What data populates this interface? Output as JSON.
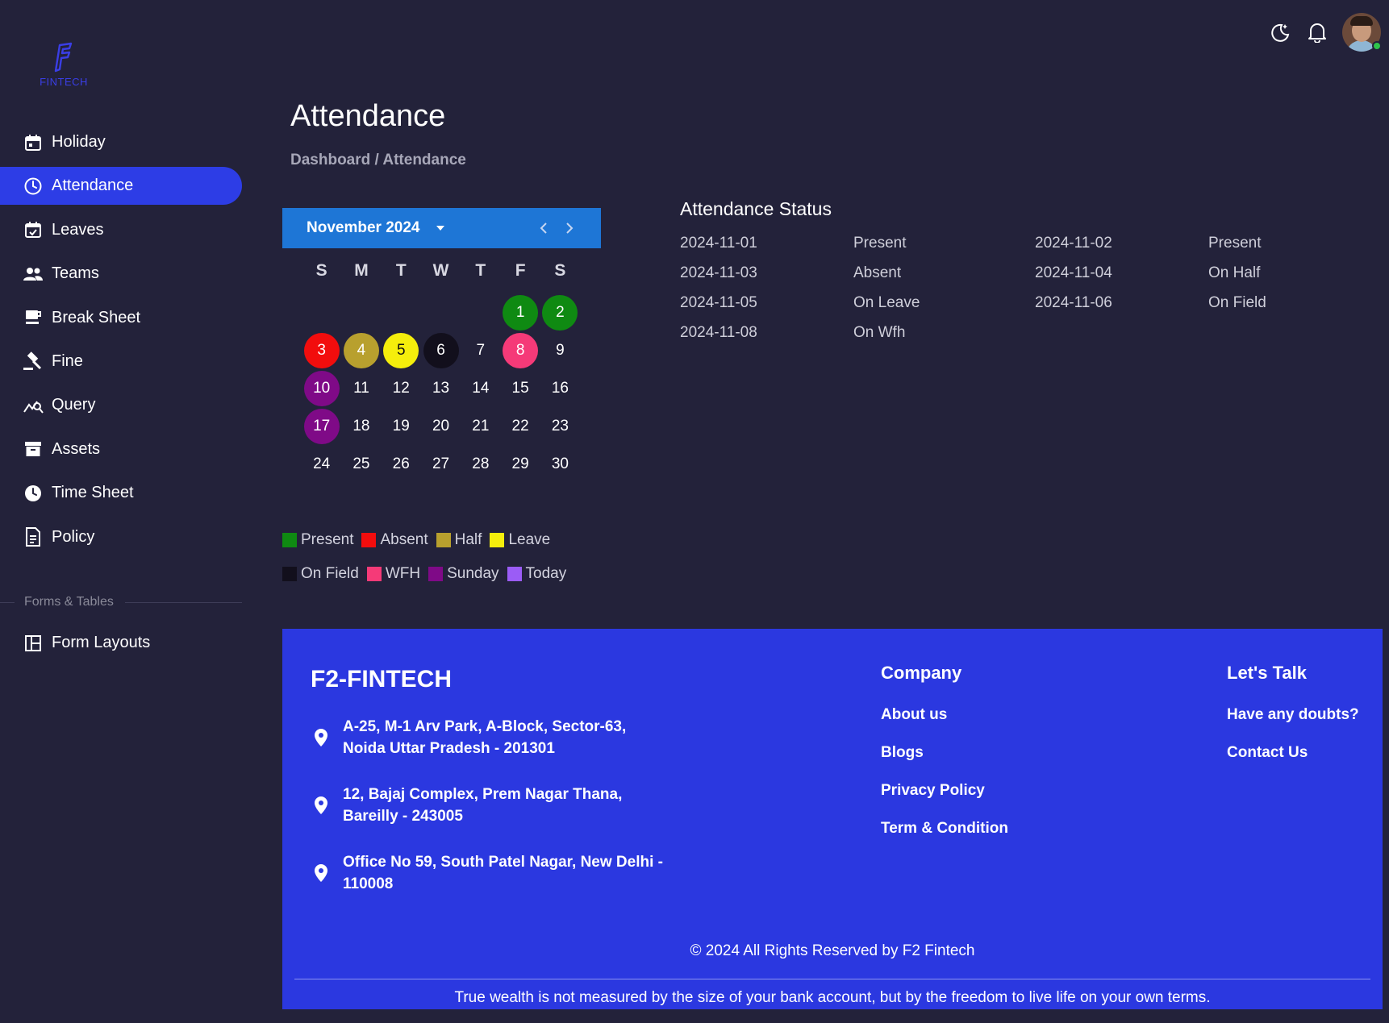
{
  "brand": {
    "logo_text": "FINTECH"
  },
  "sidebar": {
    "items": [
      {
        "label": "Holiday",
        "icon": "calendar-icon"
      },
      {
        "label": "Attendance",
        "icon": "clock-icon"
      },
      {
        "label": "Leaves",
        "icon": "calendar-check-icon"
      },
      {
        "label": "Teams",
        "icon": "people-icon"
      },
      {
        "label": "Break Sheet",
        "icon": "coffee-icon"
      },
      {
        "label": "Fine",
        "icon": "gavel-icon"
      },
      {
        "label": "Query",
        "icon": "chart-query-icon"
      },
      {
        "label": "Assets",
        "icon": "archive-box-icon"
      },
      {
        "label": "Time Sheet",
        "icon": "clock-filled-icon"
      },
      {
        "label": "Policy",
        "icon": "document-icon"
      }
    ],
    "section_label": "Forms & Tables",
    "section_items": [
      {
        "label": "Form Layouts",
        "icon": "layout-grid-icon"
      }
    ]
  },
  "header": {
    "icons": [
      "moon-icon",
      "bell-icon"
    ],
    "avatar": "user-avatar"
  },
  "page": {
    "title": "Attendance",
    "breadcrumb": "Dashboard / Attendance"
  },
  "calendar": {
    "month_label": "November 2024",
    "weekdays": [
      "S",
      "M",
      "T",
      "W",
      "T",
      "F",
      "S"
    ],
    "days": [
      {
        "d": "",
        "s": ""
      },
      {
        "d": "",
        "s": ""
      },
      {
        "d": "",
        "s": ""
      },
      {
        "d": "",
        "s": ""
      },
      {
        "d": "",
        "s": ""
      },
      {
        "d": "1",
        "s": "present"
      },
      {
        "d": "2",
        "s": "present"
      },
      {
        "d": "3",
        "s": "absent"
      },
      {
        "d": "4",
        "s": "half"
      },
      {
        "d": "5",
        "s": "leave"
      },
      {
        "d": "6",
        "s": "field"
      },
      {
        "d": "7",
        "s": ""
      },
      {
        "d": "8",
        "s": "wfh"
      },
      {
        "d": "9",
        "s": ""
      },
      {
        "d": "10",
        "s": "sunday"
      },
      {
        "d": "11",
        "s": ""
      },
      {
        "d": "12",
        "s": ""
      },
      {
        "d": "13",
        "s": ""
      },
      {
        "d": "14",
        "s": ""
      },
      {
        "d": "15",
        "s": ""
      },
      {
        "d": "16",
        "s": ""
      },
      {
        "d": "17",
        "s": "sunday"
      },
      {
        "d": "18",
        "s": ""
      },
      {
        "d": "19",
        "s": ""
      },
      {
        "d": "20",
        "s": ""
      },
      {
        "d": "21",
        "s": ""
      },
      {
        "d": "22",
        "s": ""
      },
      {
        "d": "23",
        "s": ""
      },
      {
        "d": "24",
        "s": ""
      },
      {
        "d": "25",
        "s": ""
      },
      {
        "d": "26",
        "s": ""
      },
      {
        "d": "27",
        "s": ""
      },
      {
        "d": "28",
        "s": ""
      },
      {
        "d": "29",
        "s": ""
      },
      {
        "d": "30",
        "s": ""
      }
    ]
  },
  "legend": {
    "row1": [
      {
        "label": "Present",
        "color": "#0f8a12"
      },
      {
        "label": "Absent",
        "color": "#f20d0d"
      },
      {
        "label": "Half",
        "color": "#b8a02e"
      },
      {
        "label": "Leave",
        "color": "#f5ee0c"
      }
    ],
    "row2": [
      {
        "label": "On Field",
        "color": "#120f1c"
      },
      {
        "label": "WFH",
        "color": "#f53a78"
      },
      {
        "label": "Sunday",
        "color": "#7f0a87"
      },
      {
        "label": "Today",
        "color": "#9b5cf6"
      }
    ]
  },
  "status": {
    "title": "Attendance Status",
    "rows": [
      [
        "2024-11-01",
        "Present",
        "2024-11-02",
        "Present"
      ],
      [
        "2024-11-03",
        "Absent",
        "2024-11-04",
        "On Half"
      ],
      [
        "2024-11-05",
        "On Leave",
        "2024-11-06",
        "On Field"
      ],
      [
        "2024-11-08",
        "On Wfh",
        "",
        ""
      ]
    ]
  },
  "footer": {
    "brand": "F2-FINTECH",
    "addresses": [
      "A-25, M-1 Arv Park, A-Block, Sector-63, Noida Uttar Pradesh - 201301",
      "12, Bajaj Complex, Prem Nagar Thana, Bareilly - 243005",
      "Office No 59, South Patel Nagar, New Delhi - 110008"
    ],
    "company_title": "Company",
    "company_links": [
      "About us",
      "Blogs",
      "Privacy Policy",
      "Term & Condition"
    ],
    "talk_title": "Let's Talk",
    "talk_links": [
      "Have any doubts?",
      "Contact Us"
    ],
    "copyright": "© 2024 All Rights Reserved by F2 Fintech",
    "quote": "True wealth is not measured by the size of your bank account, but by the freedom to live life on your own terms."
  },
  "colors": {
    "background": "#23223a",
    "accent": "#2d3de6",
    "calendar_header": "#1e76d6",
    "footer": "#2b38e0"
  }
}
